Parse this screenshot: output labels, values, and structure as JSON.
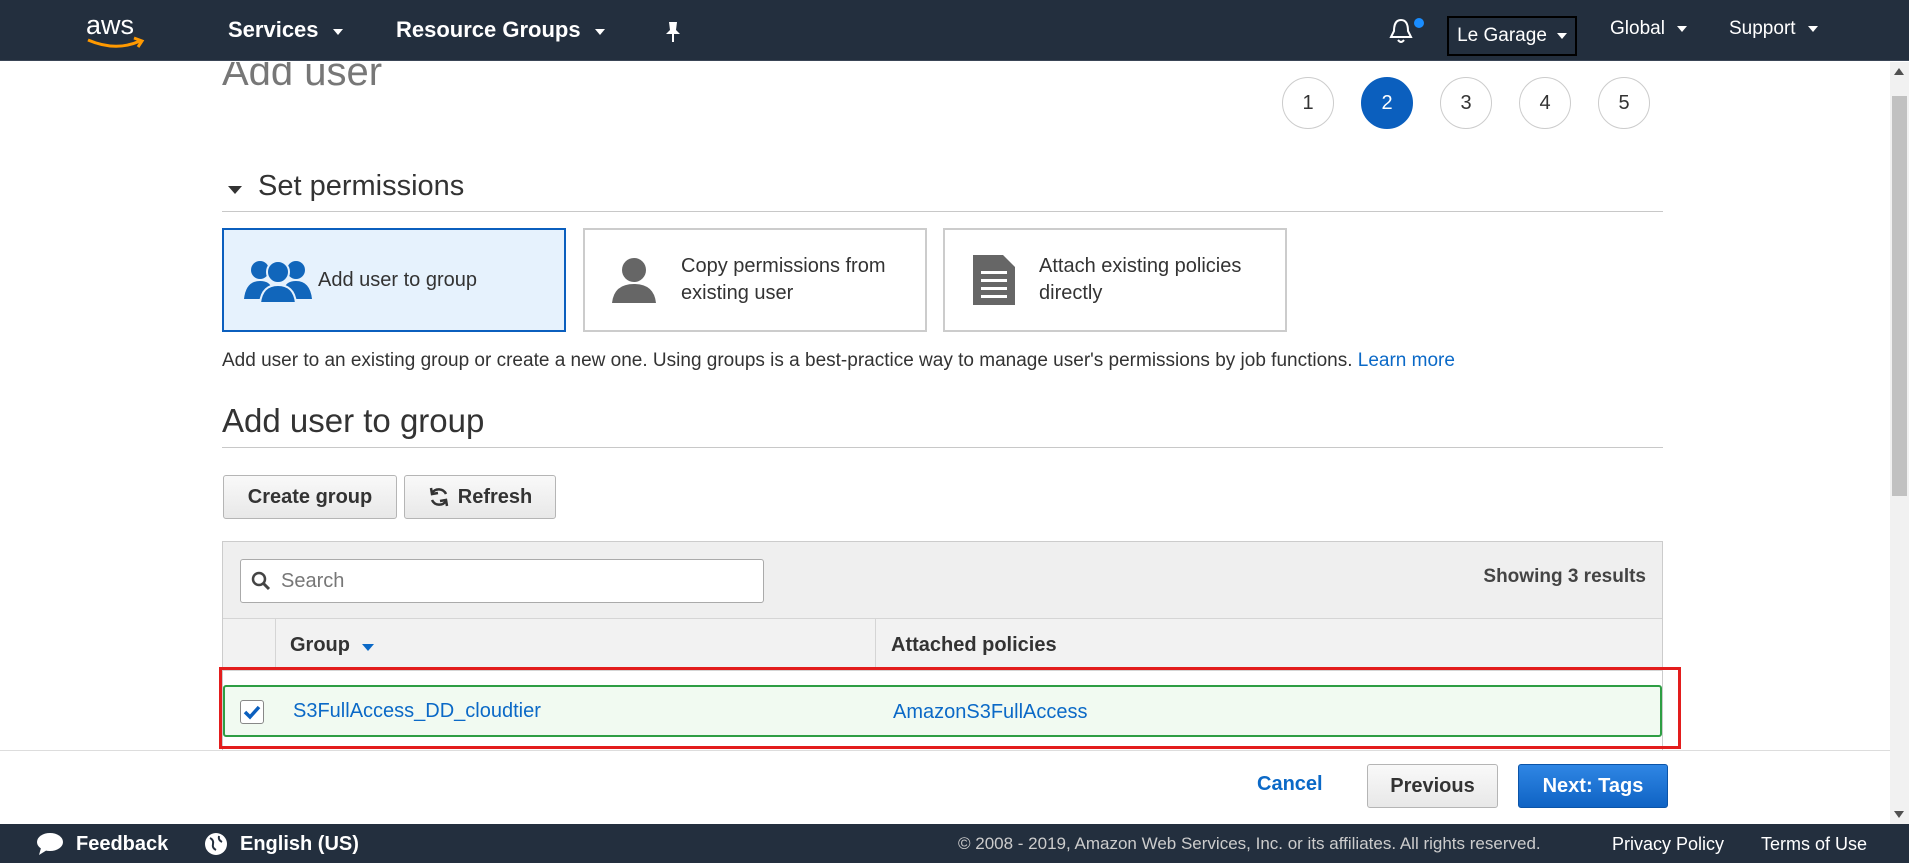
{
  "nav": {
    "logo_text": "aws",
    "services": "Services",
    "resource_groups": "Resource Groups",
    "account": "Le Garage",
    "region": "Global",
    "support": "Support"
  },
  "page": {
    "title": "Add user",
    "steps": [
      "1",
      "2",
      "3",
      "4",
      "5"
    ],
    "active_step": "2"
  },
  "permissions": {
    "heading": "Set permissions",
    "options": [
      {
        "label": "Add user to group"
      },
      {
        "label": "Copy permissions from existing user"
      },
      {
        "label": "Attach existing policies directly"
      }
    ],
    "description": "Add user to an existing group or create a new one. Using groups is a best-practice way to manage user's permissions by job functions.",
    "learn_more": "Learn more"
  },
  "group_section": {
    "heading": "Add user to group",
    "create_button": "Create group",
    "refresh_button": "Refresh",
    "search_placeholder": "Search",
    "showing": "Showing 3 results",
    "columns": {
      "group": "Group",
      "policies": "Attached policies"
    },
    "rows": [
      {
        "group": "S3FullAccess_DD_cloudtier",
        "policies": "AmazonS3FullAccess",
        "checked": true
      }
    ]
  },
  "actions": {
    "cancel": "Cancel",
    "previous": "Previous",
    "next": "Next: Tags"
  },
  "footer": {
    "feedback": "Feedback",
    "language": "English (US)",
    "copyright": "© 2008 - 2019, Amazon Web Services, Inc. or its affiliates. All rights reserved.",
    "privacy": "Privacy Policy",
    "terms": "Terms of Use"
  },
  "colors": {
    "nav_bg": "#232f3e",
    "accent_blue": "#0b5fbe",
    "link_blue": "#0b69c7",
    "selected_row_border": "#2e9e44",
    "highlight_red": "#e31d1d"
  }
}
